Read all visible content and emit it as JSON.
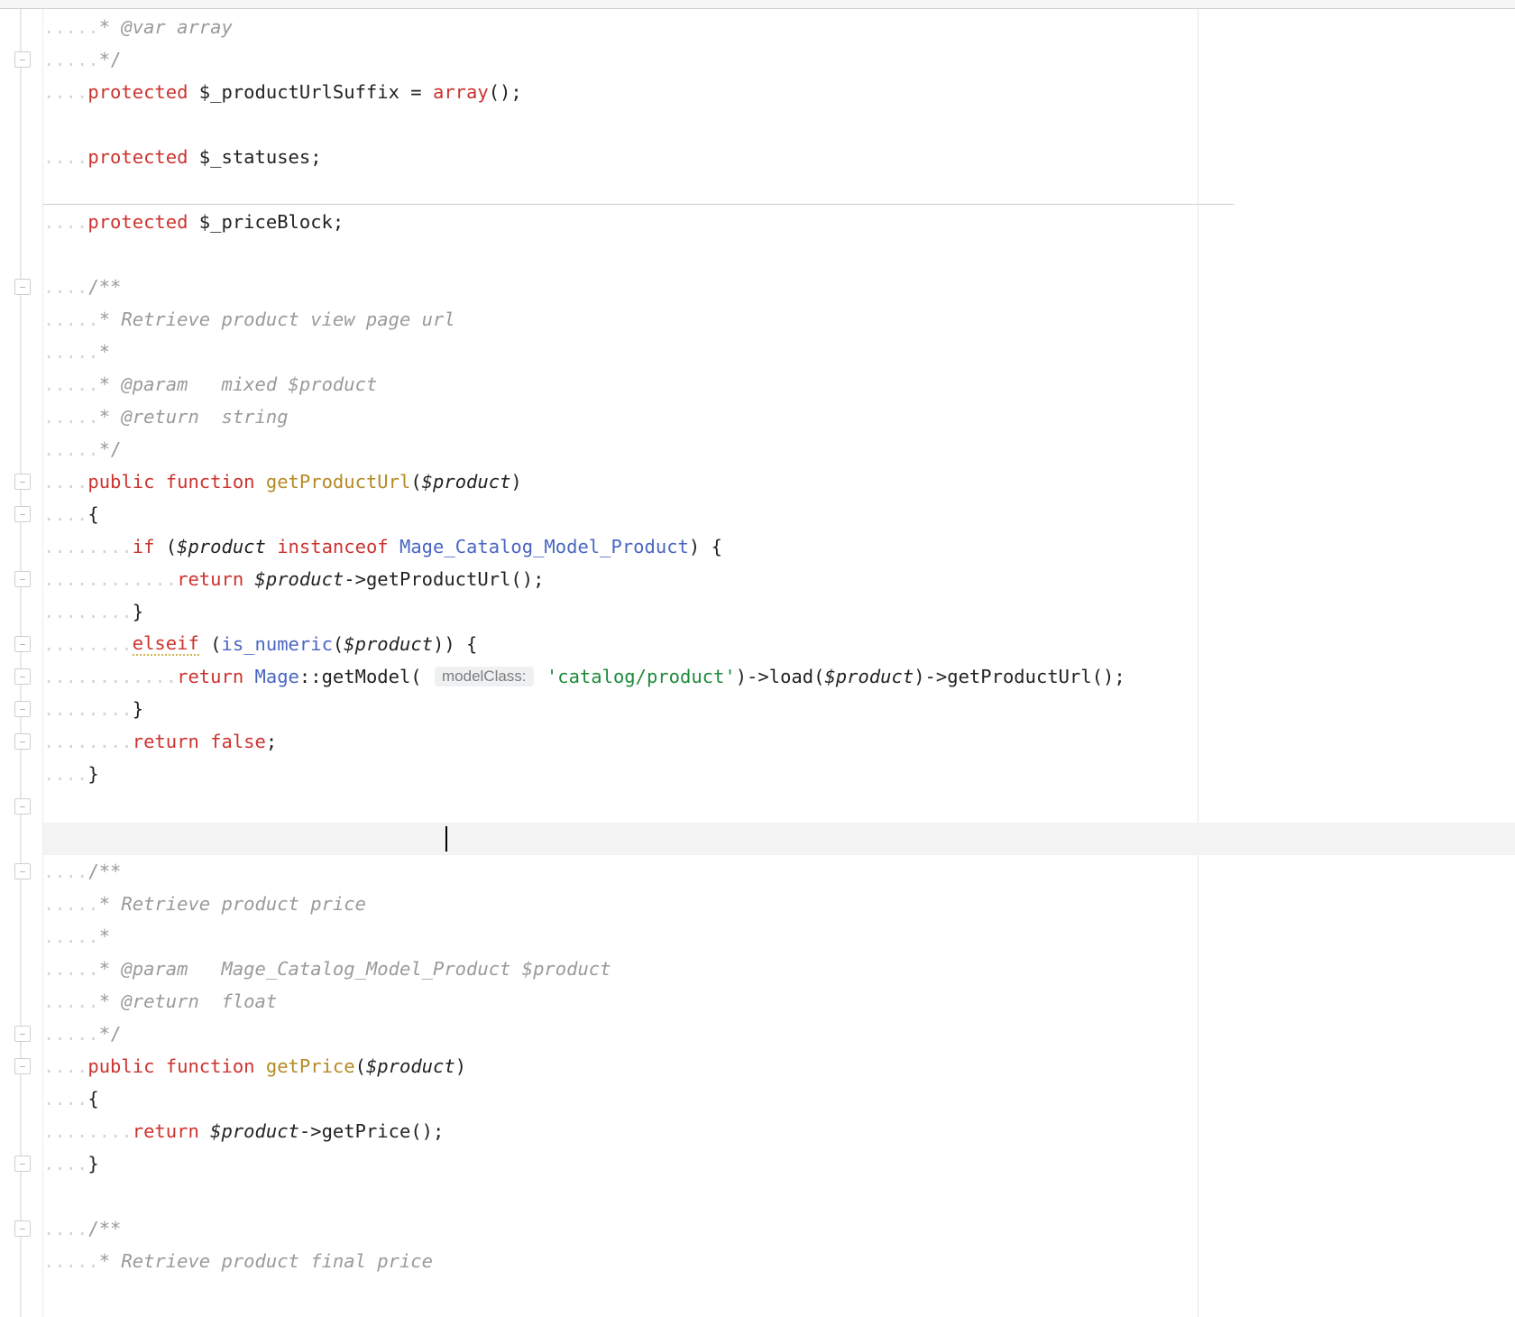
{
  "lineHeight": 36,
  "separators": [
    216
  ],
  "cursorLineIndex": 25,
  "cursorCol": 36,
  "gutterMarks": [
    {
      "line": 1,
      "kind": "fold"
    },
    {
      "line": 8,
      "kind": "fold"
    },
    {
      "line": 14,
      "kind": "fold"
    },
    {
      "line": 15,
      "kind": "fold"
    },
    {
      "line": 17,
      "kind": "fold"
    },
    {
      "line": 19,
      "kind": "fold"
    },
    {
      "line": 20,
      "kind": "fold"
    },
    {
      "line": 21,
      "kind": "fold"
    },
    {
      "line": 22,
      "kind": "fold"
    },
    {
      "line": 24,
      "kind": "fold"
    },
    {
      "line": 26,
      "kind": "fold"
    },
    {
      "line": 31,
      "kind": "fold"
    },
    {
      "line": 32,
      "kind": "fold"
    },
    {
      "line": 35,
      "kind": "fold"
    },
    {
      "line": 37,
      "kind": "fold"
    }
  ],
  "lines": [
    {
      "tokens": [
        {
          "cls": "ws",
          "t": "....."
        },
        {
          "cls": "commentb",
          "t": "* "
        },
        {
          "cls": "comment tag",
          "t": "@var "
        },
        {
          "cls": "comment",
          "t": "array"
        }
      ]
    },
    {
      "tokens": [
        {
          "cls": "ws",
          "t": "....."
        },
        {
          "cls": "commentb",
          "t": "*/"
        }
      ]
    },
    {
      "tokens": [
        {
          "cls": "ws",
          "t": "...."
        },
        {
          "cls": "keyword",
          "t": "protected "
        },
        {
          "cls": "plain",
          "t": "$_productUrlSuffix "
        },
        {
          "cls": "plain",
          "t": "= "
        },
        {
          "cls": "keyword",
          "t": "array"
        },
        {
          "cls": "plain",
          "t": "();"
        }
      ]
    },
    {
      "tokens": [
        {
          "cls": "plain",
          "t": " "
        }
      ]
    },
    {
      "tokens": [
        {
          "cls": "ws",
          "t": "...."
        },
        {
          "cls": "keyword",
          "t": "protected "
        },
        {
          "cls": "plain",
          "t": "$_statuses;"
        }
      ]
    },
    {
      "tokens": [
        {
          "cls": "plain",
          "t": " "
        }
      ]
    },
    {
      "tokens": [
        {
          "cls": "ws",
          "t": "...."
        },
        {
          "cls": "keyword",
          "t": "protected "
        },
        {
          "cls": "plain",
          "t": "$_priceBlock;"
        }
      ]
    },
    {
      "tokens": [
        {
          "cls": "plain",
          "t": " "
        }
      ]
    },
    {
      "tokens": [
        {
          "cls": "ws",
          "t": "...."
        },
        {
          "cls": "commentb",
          "t": "/**"
        }
      ]
    },
    {
      "tokens": [
        {
          "cls": "ws",
          "t": "....."
        },
        {
          "cls": "commentb",
          "t": "* "
        },
        {
          "cls": "comment",
          "t": "Retrieve product view page url"
        }
      ]
    },
    {
      "tokens": [
        {
          "cls": "ws",
          "t": "....."
        },
        {
          "cls": "commentb",
          "t": "*"
        }
      ]
    },
    {
      "tokens": [
        {
          "cls": "ws",
          "t": "....."
        },
        {
          "cls": "commentb",
          "t": "* "
        },
        {
          "cls": "comment tag",
          "t": "@param   "
        },
        {
          "cls": "comment",
          "t": "mixed $product"
        }
      ]
    },
    {
      "tokens": [
        {
          "cls": "ws",
          "t": "....."
        },
        {
          "cls": "commentb",
          "t": "* "
        },
        {
          "cls": "comment tag",
          "t": "@return  "
        },
        {
          "cls": "comment",
          "t": "string"
        }
      ]
    },
    {
      "tokens": [
        {
          "cls": "ws",
          "t": "....."
        },
        {
          "cls": "commentb",
          "t": "*/"
        }
      ]
    },
    {
      "tokens": [
        {
          "cls": "ws",
          "t": "...."
        },
        {
          "cls": "keyword",
          "t": "public "
        },
        {
          "cls": "keyword",
          "t": "function "
        },
        {
          "cls": "method",
          "t": "getProductUrl"
        },
        {
          "cls": "plain",
          "t": "("
        },
        {
          "cls": "varital",
          "t": "$product"
        },
        {
          "cls": "plain",
          "t": ")"
        }
      ]
    },
    {
      "tokens": [
        {
          "cls": "ws",
          "t": "...."
        },
        {
          "cls": "plain",
          "t": "{"
        }
      ]
    },
    {
      "tokens": [
        {
          "cls": "ws",
          "t": "........"
        },
        {
          "cls": "keyword",
          "t": "if "
        },
        {
          "cls": "plain",
          "t": "("
        },
        {
          "cls": "varital",
          "t": "$product "
        },
        {
          "cls": "keyword",
          "t": "instanceof "
        },
        {
          "cls": "type",
          "t": "Mage_Catalog_Model_Product"
        },
        {
          "cls": "plain",
          "t": ") {"
        }
      ]
    },
    {
      "tokens": [
        {
          "cls": "ws",
          "t": "............"
        },
        {
          "cls": "keyword",
          "t": "return "
        },
        {
          "cls": "varital",
          "t": "$product"
        },
        {
          "cls": "plain",
          "t": "->getProductUrl();"
        }
      ]
    },
    {
      "tokens": [
        {
          "cls": "ws",
          "t": "........"
        },
        {
          "cls": "plain",
          "t": "}"
        }
      ]
    },
    {
      "tokens": [
        {
          "cls": "ws",
          "t": "........"
        },
        {
          "cls": "elseif",
          "t": "elseif"
        },
        {
          "cls": "plain",
          "t": " ("
        },
        {
          "cls": "type",
          "t": "is_numeric"
        },
        {
          "cls": "plain",
          "t": "("
        },
        {
          "cls": "varital",
          "t": "$product"
        },
        {
          "cls": "plain",
          "t": ")) {"
        }
      ]
    },
    {
      "tokens": [
        {
          "cls": "ws",
          "t": "............"
        },
        {
          "cls": "keyword",
          "t": "return "
        },
        {
          "cls": "type",
          "t": "Mage"
        },
        {
          "cls": "plain",
          "t": "::getModel( "
        },
        {
          "cls": "param-hint",
          "t": "modelClass:"
        },
        {
          "cls": "plain",
          "t": " "
        },
        {
          "cls": "string",
          "t": "'catalog/product'"
        },
        {
          "cls": "plain",
          "t": ")->load("
        },
        {
          "cls": "varital",
          "t": "$product"
        },
        {
          "cls": "plain",
          "t": ")->getProductUrl();"
        }
      ]
    },
    {
      "tokens": [
        {
          "cls": "ws",
          "t": "........"
        },
        {
          "cls": "plain",
          "t": "}"
        }
      ]
    },
    {
      "tokens": [
        {
          "cls": "ws",
          "t": "........"
        },
        {
          "cls": "keyword",
          "t": "return "
        },
        {
          "cls": "keyword",
          "t": "false"
        },
        {
          "cls": "plain",
          "t": ";"
        }
      ]
    },
    {
      "tokens": [
        {
          "cls": "ws",
          "t": "...."
        },
        {
          "cls": "plain",
          "t": "}"
        }
      ]
    },
    {
      "tokens": [
        {
          "cls": "plain",
          "t": " "
        }
      ]
    },
    {
      "tokens": [
        {
          "cls": "plain",
          "t": " "
        }
      ]
    },
    {
      "tokens": [
        {
          "cls": "ws",
          "t": "...."
        },
        {
          "cls": "commentb",
          "t": "/**"
        }
      ]
    },
    {
      "tokens": [
        {
          "cls": "ws",
          "t": "....."
        },
        {
          "cls": "commentb",
          "t": "* "
        },
        {
          "cls": "comment",
          "t": "Retrieve product price"
        }
      ]
    },
    {
      "tokens": [
        {
          "cls": "ws",
          "t": "....."
        },
        {
          "cls": "commentb",
          "t": "*"
        }
      ]
    },
    {
      "tokens": [
        {
          "cls": "ws",
          "t": "....."
        },
        {
          "cls": "commentb",
          "t": "* "
        },
        {
          "cls": "comment tag",
          "t": "@param   "
        },
        {
          "cls": "comment",
          "t": "Mage_Catalog_Model_Product $product"
        }
      ]
    },
    {
      "tokens": [
        {
          "cls": "ws",
          "t": "....."
        },
        {
          "cls": "commentb",
          "t": "* "
        },
        {
          "cls": "comment tag",
          "t": "@return  "
        },
        {
          "cls": "comment",
          "t": "float"
        }
      ]
    },
    {
      "tokens": [
        {
          "cls": "ws",
          "t": "....."
        },
        {
          "cls": "commentb",
          "t": "*/"
        }
      ]
    },
    {
      "tokens": [
        {
          "cls": "ws",
          "t": "...."
        },
        {
          "cls": "keyword",
          "t": "public "
        },
        {
          "cls": "keyword",
          "t": "function "
        },
        {
          "cls": "method",
          "t": "getPrice"
        },
        {
          "cls": "plain",
          "t": "("
        },
        {
          "cls": "varital",
          "t": "$product"
        },
        {
          "cls": "plain",
          "t": ")"
        }
      ]
    },
    {
      "tokens": [
        {
          "cls": "ws",
          "t": "...."
        },
        {
          "cls": "plain",
          "t": "{"
        }
      ]
    },
    {
      "tokens": [
        {
          "cls": "ws",
          "t": "........"
        },
        {
          "cls": "keyword",
          "t": "return "
        },
        {
          "cls": "varital",
          "t": "$product"
        },
        {
          "cls": "plain",
          "t": "->getPrice();"
        }
      ]
    },
    {
      "tokens": [
        {
          "cls": "ws",
          "t": "...."
        },
        {
          "cls": "plain",
          "t": "}"
        }
      ]
    },
    {
      "tokens": [
        {
          "cls": "plain",
          "t": " "
        }
      ]
    },
    {
      "tokens": [
        {
          "cls": "ws",
          "t": "...."
        },
        {
          "cls": "commentb",
          "t": "/**"
        }
      ]
    },
    {
      "tokens": [
        {
          "cls": "ws",
          "t": "....."
        },
        {
          "cls": "commentb",
          "t": "* "
        },
        {
          "cls": "comment",
          "t": "Retrieve product final price"
        }
      ]
    }
  ]
}
